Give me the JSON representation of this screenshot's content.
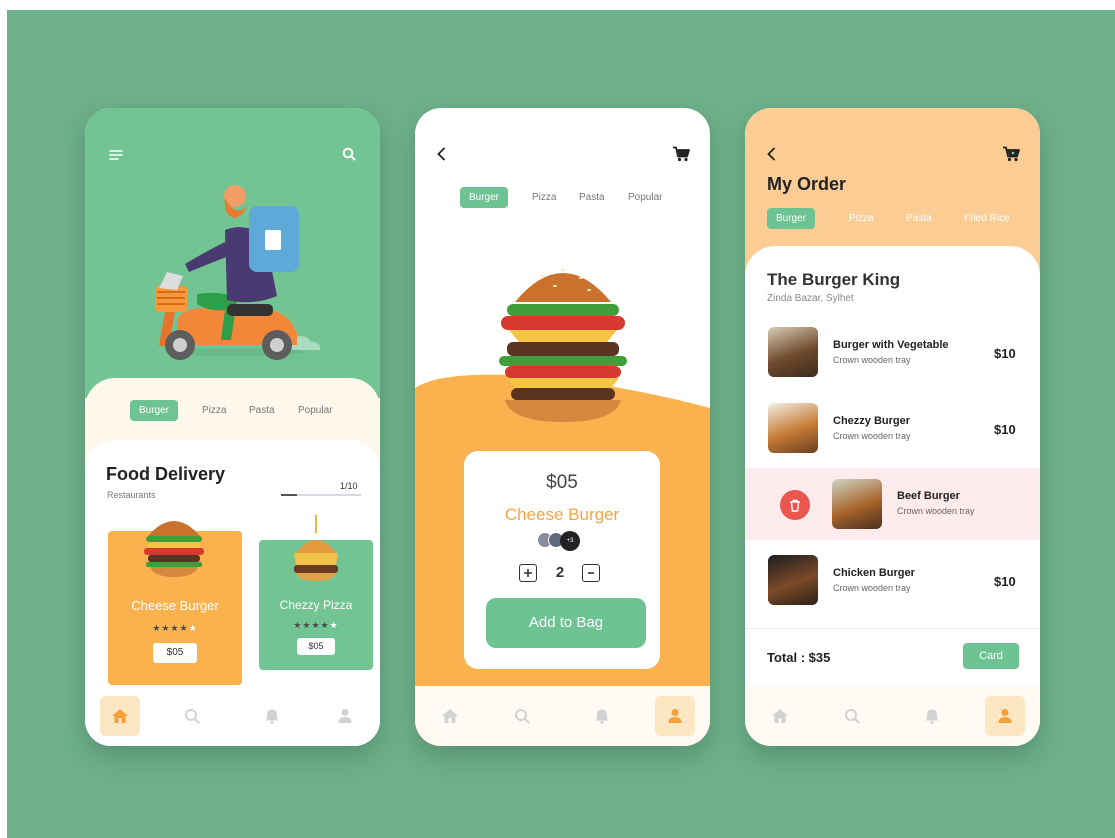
{
  "colors": {
    "background": "#6db08a",
    "green": "#6dc391",
    "orange": "#f9b24d",
    "peach": "#fbcd95",
    "pink": "#fdebee",
    "red": "#e9574f"
  },
  "icons": {
    "menu": "menu-icon",
    "search": "search-icon",
    "back": "chevron-left-icon",
    "cart": "cart-icon",
    "home": "home-icon",
    "bell": "bell-icon",
    "user": "user-icon",
    "trash": "trash-icon",
    "plus": "plus-icon",
    "minus": "minus-icon"
  },
  "screen1": {
    "categories": [
      "Burger",
      "Pizza",
      "Pasta",
      "Popular"
    ],
    "title": "Food Delivery",
    "subtitle": "Restaurants",
    "pager": "1/10",
    "progress": 0.2,
    "cards": [
      {
        "name": "Cheese Burger",
        "rating": 4,
        "price": "$05"
      },
      {
        "name": "Chezzy Pizza",
        "rating": 4,
        "price": "$05"
      }
    ]
  },
  "screen2": {
    "categories": [
      "Burger",
      "Pizza",
      "Pasta",
      "Popular"
    ],
    "price": "$05",
    "name": "Cheese Burger",
    "avatar_more": "+3",
    "quantity": "2",
    "button": "Add to Bag"
  },
  "screen3": {
    "title": "My Order",
    "categories": [
      "Burger",
      "Pizza",
      "Pasta",
      "Fried Rice"
    ],
    "restaurant": "The Burger King",
    "location": "Zinda Bazar, Sylhet",
    "items": [
      {
        "name": "Burger with Vegetable",
        "desc": "Crown wooden tray",
        "price": "$10"
      },
      {
        "name": "Chezzy Burger",
        "desc": "Crown wooden tray",
        "price": "$10"
      },
      {
        "name": "Beef Burger",
        "desc": "Crown wooden tray",
        "price": ""
      },
      {
        "name": "Chicken Burger",
        "desc": "Crown wooden tray",
        "price": "$10"
      }
    ],
    "total_label": "Total :",
    "total_value": "$35",
    "pay_button": "Card"
  }
}
